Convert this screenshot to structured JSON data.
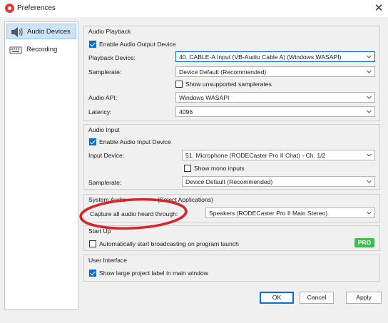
{
  "window": {
    "title": "Preferences",
    "close_glyph": "✕",
    "app_icon": "app-logo-icon"
  },
  "sidebar": {
    "items": [
      {
        "label": "Audio Devices",
        "icon": "speaker-icon",
        "selected": true
      },
      {
        "label": "Recording",
        "icon": "keyboard-icon",
        "selected": false
      }
    ]
  },
  "audio_playback": {
    "title": "Audio Playback",
    "enable_output_label": "Enable Audio Output Device",
    "enable_output_checked": true,
    "playback_device_label": "Playback Device:",
    "playback_device_value": "40. CABLE-A Input (VB-Audio Cable A) (Windows WASAPI)",
    "samplerate_label": "Samplerate:",
    "samplerate_value": "Device Default (Recommended)",
    "show_unsupported_label": "Show unsupported samplerates",
    "show_unsupported_checked": false,
    "audio_api_label": "Audio API:",
    "audio_api_value": "Windows WASAPI",
    "latency_label": "Latency:",
    "latency_value": "4096"
  },
  "audio_input": {
    "title": "Audio Input",
    "enable_input_label": "Enable Audio Input Device",
    "enable_input_checked": true,
    "input_device_label": "Input Device:",
    "input_device_value": "51. Microphone (RODECaster Pro II Chat) - Ch. 1/2",
    "show_mono_label": "Show mono inputs",
    "show_mono_checked": false,
    "samplerate_label": "Samplerate:",
    "samplerate_value": "Device Default (Recommended)"
  },
  "system_capture": {
    "title_left": "System Audio",
    "title_right": "(Select Applications)",
    "capture_label": "Capture all audio heard through:",
    "capture_value": "Speakers (RODECaster Pro II Main Stereo)"
  },
  "start_up": {
    "title": "Start Up",
    "auto_broadcast_label": "Automatically start broadcasting on program launch",
    "auto_broadcast_checked": false,
    "pro_badge": "PRO"
  },
  "user_interface": {
    "title": "User Interface",
    "large_label_label": "Show large project label in main window",
    "large_label_checked": true
  },
  "buttons": {
    "ok": "OK",
    "cancel": "Cancel",
    "apply": "Apply"
  },
  "colors": {
    "accent": "#0a6fd4",
    "pro_green": "#3cbf4e",
    "annotation_red": "#d8232a",
    "selection": "#cce4f7"
  }
}
